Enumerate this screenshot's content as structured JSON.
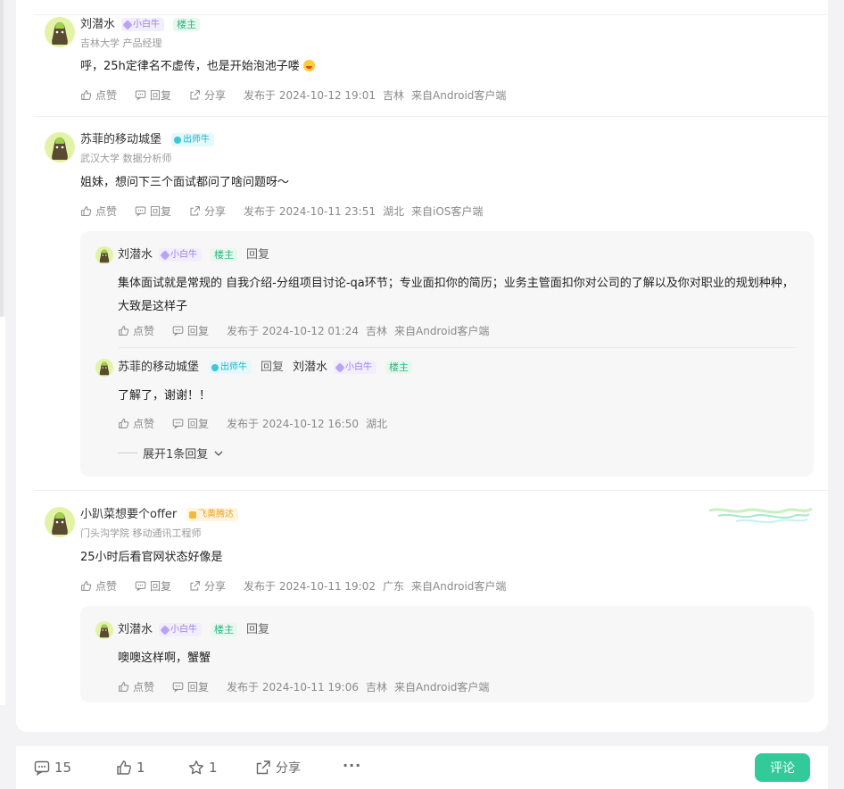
{
  "comments": [
    {
      "name": "刘潜水",
      "level": "小白牛",
      "host_label": "楼主",
      "sub": "吉林大学 产品经理",
      "content": "呼，25h定律名不虚传，也是开始泡池子喽",
      "like": "点赞",
      "reply": "回复",
      "share": "分享",
      "time": "发布于 2024-10-12 19:01",
      "location": "吉林",
      "source": "来自Android客户端"
    },
    {
      "name": "苏菲的移动城堡",
      "level": "出师牛",
      "sub": "武汉大学 数据分析师",
      "content": "姐妹，想问下三个面试都问了啥问题呀～",
      "like": "点赞",
      "reply": "回复",
      "share": "分享",
      "time": "发布于 2024-10-11 23:51",
      "location": "湖北",
      "source": "来自iOS客户端",
      "replies": [
        {
          "name": "刘潜水",
          "level": "小白牛",
          "host_label": "楼主",
          "reply_word": "回复",
          "content": "集体面试就是常规的 自我介绍-分组项目讨论-qa环节；专业面扣你的简历；业务主管面扣你对公司的了解以及你对职业的规划种种，大致是这样子",
          "like": "点赞",
          "reply": "回复",
          "time": "发布于 2024-10-12 01:24",
          "location": "吉林",
          "source": "来自Android客户端"
        },
        {
          "name": "苏菲的移动城堡",
          "level": "出师牛",
          "reply_word": "回复",
          "target_name": "刘潜水",
          "target_level": "小白牛",
          "host_label": "楼主",
          "content": "了解了，谢谢！！",
          "like": "点赞",
          "reply": "回复",
          "time": "发布于 2024-10-12 16:50",
          "location": "湖北"
        }
      ],
      "expand_label": "展开1条回复"
    },
    {
      "name": "小趴菜想要个offer",
      "level": "飞黄腾达",
      "sub": "门头沟学院 移动通讯工程师",
      "content": "25小时后看官网状态好像是",
      "like": "点赞",
      "reply": "回复",
      "share": "分享",
      "time": "发布于 2024-10-11 19:02",
      "location": "广东",
      "source": "来自Android客户端",
      "replies": [
        {
          "name": "刘潜水",
          "level": "小白牛",
          "host_label": "楼主",
          "reply_word": "回复",
          "content": "噢噢这样啊，蟹蟹",
          "like": "点赞",
          "reply": "回复",
          "time": "发布于 2024-10-11 19:06",
          "location": "吉林",
          "source": "来自Android客户端"
        }
      ]
    }
  ],
  "bottom_bar": {
    "comment_count": "15",
    "like_count": "1",
    "star_count": "1",
    "share_label": "分享",
    "more_label": "···",
    "comment_button": "评论"
  },
  "colors": {
    "accent": "#32ca99",
    "host_badge": "#2ab57d",
    "avatar_bg": "#e2f3a6"
  }
}
